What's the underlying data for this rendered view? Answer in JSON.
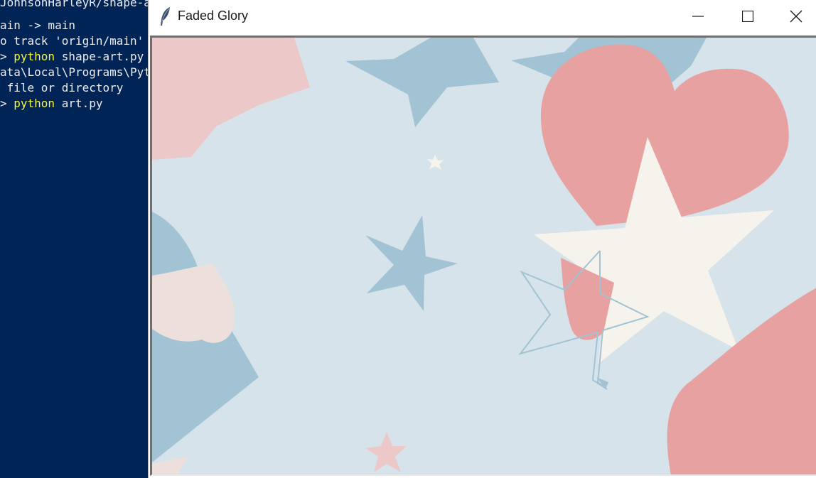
{
  "terminal": {
    "lines": [
      {
        "pre": "JohnsonHarleyR/shape-a",
        "kw": "",
        "post": ""
      },
      {
        "pre": "ain -> main",
        "kw": "",
        "post": ""
      },
      {
        "pre": "o track 'origin/main'",
        "kw": "",
        "post": ""
      },
      {
        "pre": "> ",
        "kw": "python",
        "post": " shape-art.py"
      },
      {
        "pre": "ata\\Local\\Programs\\Pyt",
        "kw": "",
        "post": ""
      },
      {
        "pre": " file or directory",
        "kw": "",
        "post": ""
      },
      {
        "pre": "> ",
        "kw": "python",
        "post": " art.py"
      }
    ]
  },
  "window": {
    "title": "Faded Glory",
    "icons": {
      "app": "feather-icon",
      "minimize": "minimize-icon",
      "maximize": "maximize-icon",
      "close": "close-icon"
    }
  },
  "palette": {
    "background": "#d6e3ea",
    "blue": "#a2c3d3",
    "pink": "#e8a1a1",
    "light_pink": "#ecc8c9",
    "cream": "#f6f3ec",
    "blush": "#ede0dc"
  }
}
